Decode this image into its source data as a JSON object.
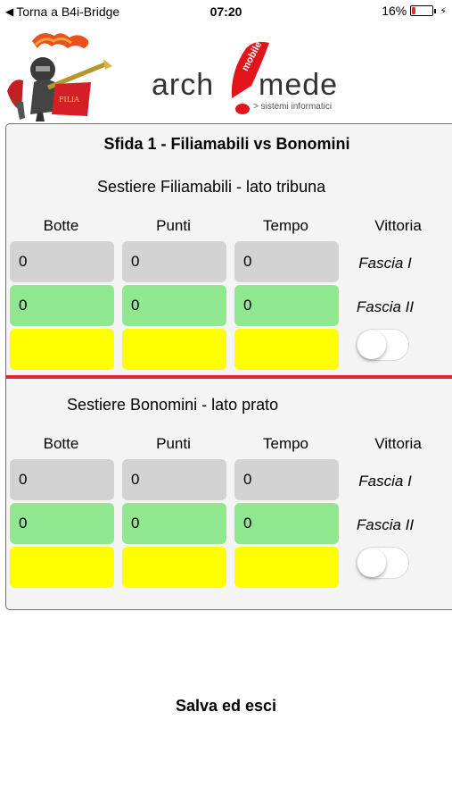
{
  "status_bar": {
    "back_label": "Torna a B4i-Bridge",
    "time": "07:20",
    "battery_pct": "16%",
    "battery_level": 0.16,
    "battery_color": "#e0322a"
  },
  "logos": {
    "brand_main": "arch!mede",
    "brand_tag": "mobile",
    "brand_sub": "> sistemi informatici"
  },
  "match": {
    "title": "Sfida 1 - Filiamabili vs Bonomini",
    "sections": [
      {
        "title": "Sestiere Filiamabili - lato tribuna",
        "headers": [
          "Botte",
          "Punti",
          "Tempo",
          "Vittoria"
        ],
        "row1": [
          "0",
          "0",
          "0"
        ],
        "row2": [
          "0",
          "0",
          "0"
        ],
        "fascia1": "Fascia I",
        "fascia2": "Fascia II",
        "victory_on": false
      },
      {
        "title": "Sestiere Bonomini - lato prato",
        "headers": [
          "Botte",
          "Punti",
          "Tempo",
          "Vittoria"
        ],
        "row1": [
          "0",
          "0",
          "0"
        ],
        "row2": [
          "0",
          "0",
          "0"
        ],
        "fascia1": "Fascia I",
        "fascia2": "Fascia II",
        "victory_on": false
      }
    ]
  },
  "colors": {
    "grey_cell": "#d3d3d3",
    "green_cell": "#8fe88f",
    "yellow_cell": "#ffff00",
    "divider": "#e0262a",
    "brand_red": "#e4131b"
  },
  "actions": {
    "save_label": "Salva ed esci"
  }
}
